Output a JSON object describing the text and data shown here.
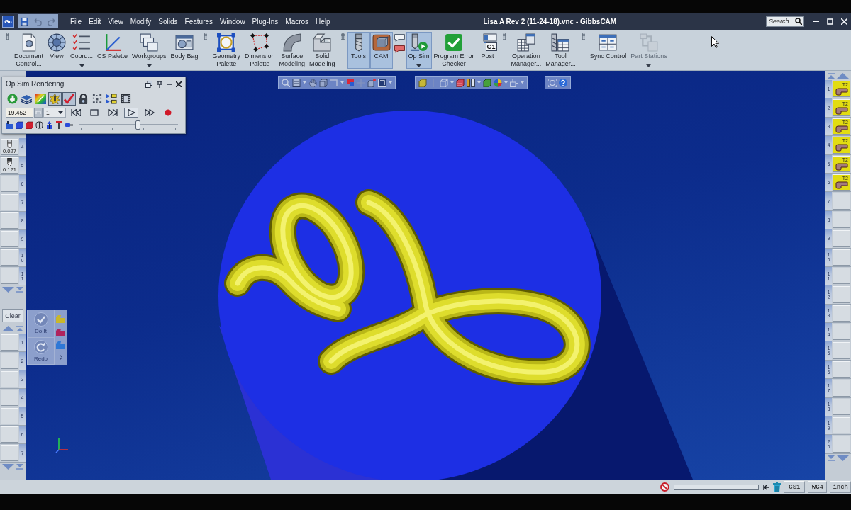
{
  "title_bar": {
    "app_badge": "Gc",
    "quick_access": [
      {
        "disabled": false
      },
      {
        "disabled": true
      },
      {
        "disabled": true
      }
    ],
    "menu": [
      "File",
      "Edit",
      "View",
      "Modify",
      "Solids",
      "Features",
      "Window",
      "Plug-Ins",
      "Macros",
      "Help"
    ],
    "title": "Lisa A Rev 2 (11-24-18).vnc - GibbsCAM",
    "search": {
      "placeholder": "Search"
    }
  },
  "ribbon": {
    "groups": [
      {
        "items": [
          {
            "kind": "large",
            "label": "Document\nControl...",
            "on": false,
            "disabled": false,
            "menu": false
          },
          {
            "kind": "large",
            "label": "View",
            "on": false,
            "disabled": false,
            "menu": false
          },
          {
            "kind": "large",
            "label": "Coord...",
            "on": false,
            "disabled": false,
            "menu": true
          },
          {
            "kind": "large",
            "label": "CS Palette",
            "on": false,
            "disabled": false,
            "menu": false
          },
          {
            "kind": "large",
            "label": "Workgroups",
            "on": false,
            "disabled": false,
            "menu": true
          },
          {
            "kind": "large",
            "label": "Body Bag",
            "on": false,
            "disabled": false,
            "menu": false
          }
        ]
      },
      {
        "items": [
          {
            "kind": "large",
            "label": "Geometry\nPalette",
            "on": false,
            "disabled": false,
            "menu": false
          },
          {
            "kind": "large",
            "label": "Dimension\nPalette",
            "on": false,
            "disabled": false,
            "menu": false
          },
          {
            "kind": "large",
            "label": "Surface\nModeling",
            "on": false,
            "disabled": false,
            "menu": false
          },
          {
            "kind": "large",
            "label": "Solid\nModeling",
            "on": false,
            "disabled": false,
            "menu": false
          }
        ]
      },
      {
        "items": [
          {
            "kind": "large",
            "label": "Tools",
            "on": true,
            "disabled": false,
            "menu": false
          },
          {
            "kind": "large",
            "label": "CAM",
            "on": true,
            "disabled": false,
            "menu": false
          },
          {
            "kind": "small_stack",
            "disabled": false
          },
          {
            "kind": "large",
            "label": "Op Sim",
            "on": true,
            "disabled": false,
            "menu": true
          },
          {
            "kind": "large",
            "label": "Program Error\nChecker",
            "on": false,
            "disabled": false,
            "menu": false
          },
          {
            "kind": "large",
            "label": "Post",
            "icon_text": "G1",
            "on": false,
            "disabled": false,
            "menu": false
          }
        ]
      },
      {
        "items": [
          {
            "kind": "large",
            "label": "Operation\nManager...",
            "on": false,
            "disabled": false,
            "menu": false
          },
          {
            "kind": "large",
            "label": "Tool\nManager...",
            "on": false,
            "disabled": false,
            "menu": false
          }
        ]
      },
      {
        "items": [
          {
            "kind": "large",
            "label": "Sync Control",
            "on": false,
            "disabled": false,
            "menu": false
          },
          {
            "kind": "large",
            "label": "Part Stations",
            "on": false,
            "disabled": true,
            "menu": true
          }
        ]
      }
    ]
  },
  "op_sim_panel": {
    "title": "Op Sim Rendering",
    "render_buttons": [
      {
        "pressed": false
      },
      {
        "pressed": false
      },
      {
        "pressed": false
      },
      {
        "pressed": true
      },
      {
        "pressed": true
      },
      {
        "pressed": false
      },
      {
        "pressed": false
      },
      {
        "pressed": false
      },
      {
        "pressed": false
      }
    ],
    "time_field": {
      "value": "19.452"
    },
    "step_select": {
      "value": "1"
    },
    "playback": [
      {
        "pressed": false
      },
      {
        "pressed": false
      },
      {
        "pressed": false
      },
      {
        "pressed": true
      },
      {
        "pressed": false
      },
      {
        "pressed": false
      }
    ],
    "speed_slider": {
      "level": 0.6
    }
  },
  "left_tool_strip": {
    "upper_slots": [
      {
        "kind": "endmill",
        "number": "4",
        "value": "0.027"
      },
      {
        "kind": "drill",
        "number": "5",
        "value": "0.121"
      },
      {
        "kind": "empty",
        "number": "6"
      },
      {
        "kind": "empty",
        "number": "7"
      },
      {
        "kind": "empty",
        "number": "8"
      },
      {
        "kind": "empty",
        "number": "9"
      },
      {
        "kind": "empty",
        "number": "10"
      },
      {
        "kind": "empty",
        "number": "11"
      }
    ],
    "clear_button": "Clear",
    "lower_slots": [
      {
        "number": "1"
      },
      {
        "number": "2"
      },
      {
        "number": "3"
      },
      {
        "number": "4"
      },
      {
        "number": "5"
      },
      {
        "number": "6"
      },
      {
        "number": "7"
      }
    ]
  },
  "process_panel": {
    "actions": [
      {
        "label": "Do It",
        "disabled": true
      },
      {
        "label": "Redo",
        "disabled": true
      }
    ],
    "shapes": [
      {
        "color": "#c9b72c"
      },
      {
        "color": "#b0245e"
      },
      {
        "color": "#2f78d6"
      }
    ]
  },
  "right_operation_strip": {
    "slots": [
      {
        "kind": "operation",
        "number": "1",
        "label": "T2"
      },
      {
        "kind": "operation",
        "number": "2",
        "label": "T2"
      },
      {
        "kind": "operation",
        "number": "3",
        "label": "T2"
      },
      {
        "kind": "operation",
        "number": "4",
        "label": "T2"
      },
      {
        "kind": "operation",
        "number": "5",
        "label": "T2"
      },
      {
        "kind": "operation",
        "number": "6",
        "label": "T2"
      },
      {
        "kind": "empty",
        "number": "7"
      },
      {
        "kind": "empty",
        "number": "8"
      },
      {
        "kind": "empty",
        "number": "9"
      },
      {
        "kind": "empty",
        "number": "10"
      },
      {
        "kind": "empty",
        "number": "11"
      },
      {
        "kind": "empty",
        "number": "12"
      },
      {
        "kind": "empty",
        "number": "13"
      },
      {
        "kind": "empty",
        "number": "14"
      },
      {
        "kind": "empty",
        "number": "15"
      },
      {
        "kind": "empty",
        "number": "16"
      },
      {
        "kind": "empty",
        "number": "17"
      },
      {
        "kind": "empty",
        "number": "18"
      },
      {
        "kind": "empty",
        "number": "19"
      },
      {
        "kind": "empty",
        "number": "20"
      }
    ]
  },
  "status_bar": {
    "fields": [
      "CS1",
      "WG4",
      "inch"
    ]
  }
}
